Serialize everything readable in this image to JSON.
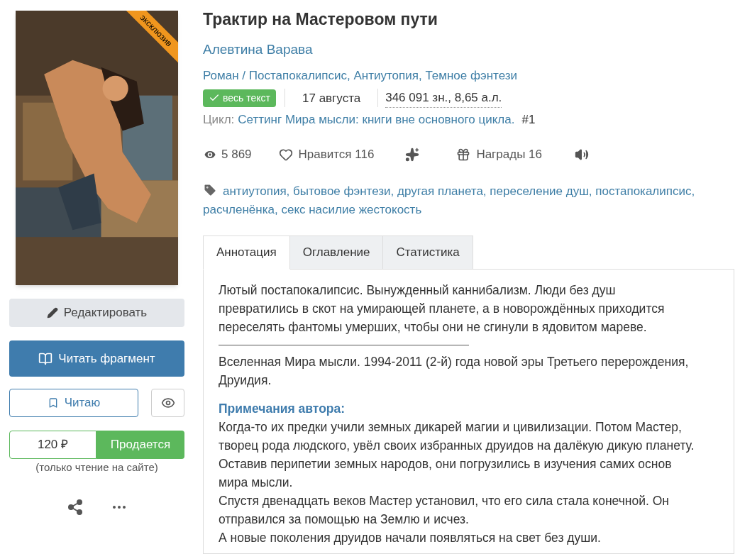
{
  "cover": {
    "kind": "picture",
    "ribbon": "эксклюзив"
  },
  "actions": {
    "edit": "Редактировать",
    "read_fragment": "Читать фрагмент",
    "reading": "Читаю",
    "price": "120 ₽",
    "sale": "Продается",
    "note": "(только чтение на сайте)"
  },
  "book": {
    "title": "Трактир на Мастеровом пути",
    "author": "Алевтина Варава",
    "genres": [
      {
        "text": "Роман",
        "separator": " / "
      },
      {
        "text": "Постапокалипсис",
        "separator": ", "
      },
      {
        "text": "Антиутопия",
        "separator": ", "
      },
      {
        "text": "Темное фэнтези"
      }
    ],
    "status": "весь текст",
    "date": "17 августа",
    "size": "346 091 зн., 8,65 а.л.",
    "cycle": {
      "label": "Цикл:",
      "name": "Сеттинг Мира мысли: книги вне основного цикла.",
      "number": "#1"
    },
    "stats": {
      "views": "5 869",
      "likes": "Нравится 116",
      "awards": "Награды 16"
    },
    "tags": [
      {
        "text": "антиутопия",
        "separator": ","
      },
      {
        "text": "бытовое фэнтези",
        "separator": ","
      },
      {
        "text": "другая планета",
        "separator": ","
      },
      {
        "text": "переселение душ",
        "separator": ","
      },
      {
        "text": "постапокалипсис",
        "separator": ","
      },
      {
        "text": "расчленёнка",
        "separator": ","
      },
      {
        "text": "секс насилие жестокость"
      }
    ]
  },
  "tabs": [
    {
      "label": "Аннотация",
      "selected": true
    },
    {
      "label": "Оглавление",
      "selected": false
    },
    {
      "label": "Статистика",
      "selected": false
    }
  ],
  "annotation": [
    {
      "kind": "text",
      "text": "Лютый постапокалипсис. Вынужденный каннибализм. Люди без душ превратились в скот на умирающей планете, а в новорождённых приходится переселять фантомы умерших, чтобы они не сгинули в ядовитом мареве."
    },
    {
      "kind": "rule"
    },
    {
      "kind": "text",
      "text": "Вселенная Мира мысли. 1994-2011 (2-й) года новой эры Третьего перерождения, Друидия."
    },
    {
      "kind": "heading",
      "text": "Примечания автора:"
    },
    {
      "kind": "line",
      "text": "Когда-то их предки учили земных дикарей магии и цивилизации. Потом Мастер, творец рода людского, увёл своих избранных друидов на далёкую дикую планету."
    },
    {
      "kind": "line",
      "text": "Оставив перипетии земных народов, они погрузились в изучения самих основ мира мысли."
    },
    {
      "kind": "line",
      "text": "Спустя двенадцать веков Мастер установил, что его сила стала конечной. Он отправился за помощью на Землю и исчез."
    },
    {
      "kind": "line",
      "text": "А новые поколения друидов начали появляться на свет без души."
    }
  ]
}
